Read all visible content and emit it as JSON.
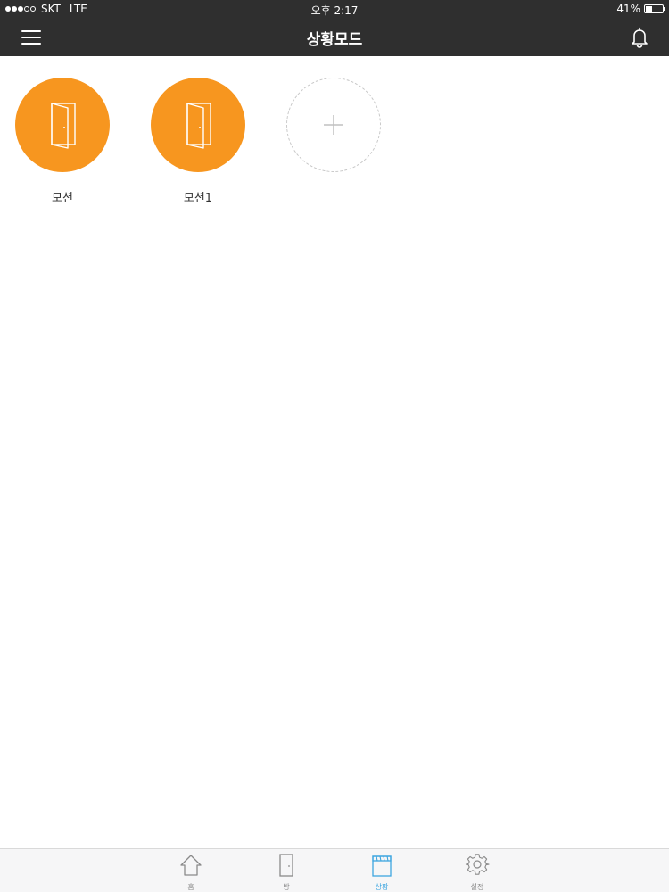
{
  "status_bar": {
    "carrier": "SKT",
    "network": "LTE",
    "time": "오후 2:17",
    "battery_label": "41%",
    "battery_level": 0.41,
    "signal_bars_filled": 3,
    "signal_bars_total": 5
  },
  "nav": {
    "title": "상황모드",
    "menu_icon": "hamburger-menu-icon",
    "bell_icon": "bell-icon"
  },
  "scenes": [
    {
      "label": "모션",
      "icon": "door-icon",
      "color": "#f7961f"
    },
    {
      "label": "모션1",
      "icon": "door-icon",
      "color": "#f7961f"
    }
  ],
  "add_scene": {
    "icon": "plus-icon",
    "border_color": "#c8c8c8"
  },
  "tabs": [
    {
      "label": "홈",
      "icon": "home-icon",
      "active": false
    },
    {
      "label": "방",
      "icon": "door-icon",
      "active": false
    },
    {
      "label": "상황",
      "icon": "clapperboard-icon",
      "active": true
    },
    {
      "label": "설정",
      "icon": "gear-icon",
      "active": false
    }
  ],
  "colors": {
    "header_bg": "#2f2f2f",
    "accent_orange": "#f7961f",
    "active_tab": "#3ea6e0",
    "inactive_tab": "#8a8a8a"
  }
}
